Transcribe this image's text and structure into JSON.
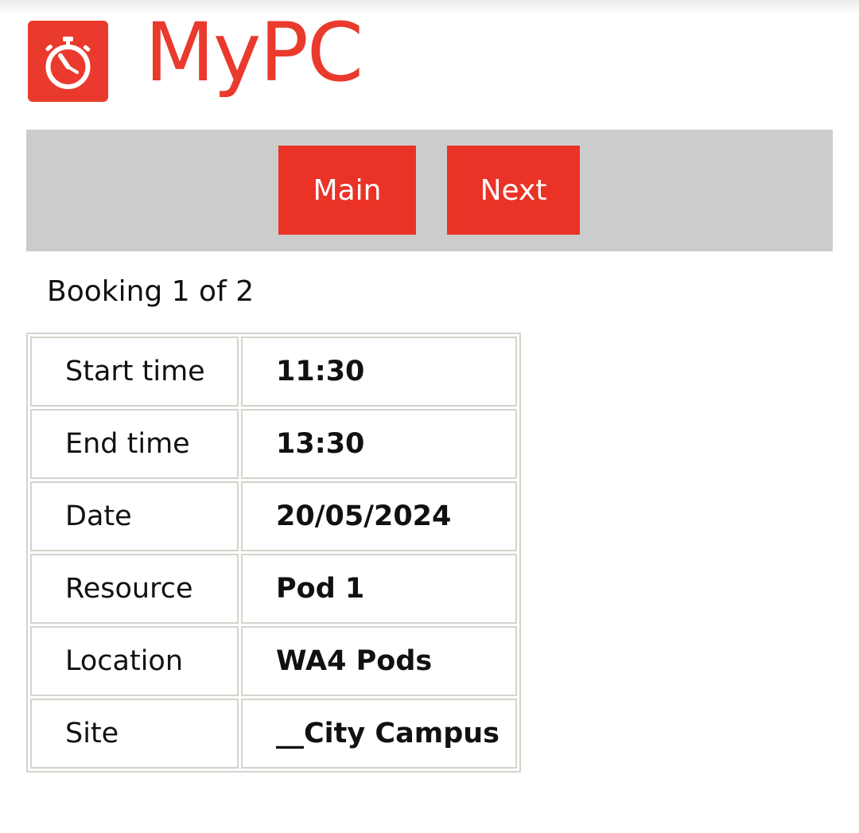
{
  "app": {
    "name": "MyPC",
    "logo_icon": "stopwatch-icon",
    "brand_color": "#ea3a2d"
  },
  "nav": {
    "main_label": "Main",
    "next_label": "Next",
    "bar_color": "#cccccc",
    "button_color": "#ea3326"
  },
  "booking": {
    "counter": "Booking 1 of 2",
    "rows": [
      {
        "label": "Start time",
        "value": "11:30"
      },
      {
        "label": "End time",
        "value": "13:30"
      },
      {
        "label": "Date",
        "value": "20/05/2024"
      },
      {
        "label": "Resource",
        "value": "Pod 1"
      },
      {
        "label": "Location",
        "value": "WA4 Pods"
      },
      {
        "label": "Site",
        "value": "__City Campus"
      }
    ]
  }
}
